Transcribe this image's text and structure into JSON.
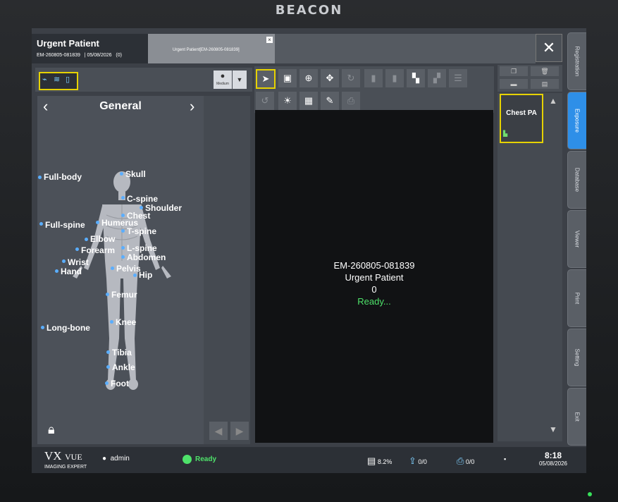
{
  "monitor": {
    "brand": "BEACON"
  },
  "patient": {
    "name": "Urgent Patient",
    "id": "EM-260805-081839",
    "date": "05/08/2026",
    "count": "(0)",
    "tab_label": "Urgent Patient[EM-260805-081839]"
  },
  "nav": {
    "items": [
      "Registration",
      "Exposure",
      "Database",
      "Viewer",
      "Print",
      "Setting",
      "Exit"
    ],
    "active": "Exposure"
  },
  "left_panel": {
    "size_label": "Medium",
    "category": "General",
    "body_parts": [
      "Skull",
      "Full-body",
      "C-spine",
      "Shoulder",
      "Chest",
      "Full-spine",
      "Humerus",
      "T-spine",
      "Elbow",
      "L-spine",
      "Forearm",
      "Abdomen",
      "Wrist",
      "Pelvis",
      "Hand",
      "Hip",
      "Femur",
      "Knee",
      "Long-bone",
      "Tibia",
      "Ankle",
      "Foot"
    ]
  },
  "viewer": {
    "id": "EM-260805-081839",
    "name": "Urgent Patient",
    "index": "0",
    "status": "Ready..."
  },
  "protocols": {
    "items": [
      "Chest PA"
    ]
  },
  "status_bar": {
    "brand_main": "VX",
    "brand_sub": "VUE",
    "brand_tag": "IMAGING EXPERT",
    "user": "admin",
    "status": "Ready",
    "disk": "8.2%",
    "upload": "0/0",
    "print": "0/0",
    "time": "8:18",
    "date": "05/08/2026"
  },
  "colors": {
    "accent": "#2e8fe8",
    "highlight": "#e6d200",
    "ready": "#4ee26a"
  }
}
